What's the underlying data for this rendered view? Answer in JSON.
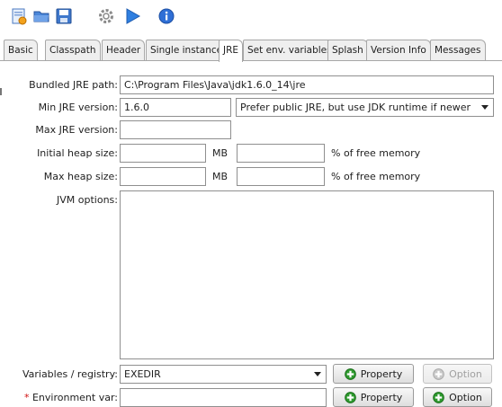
{
  "toolbar": {
    "icons": [
      "new-config-icon",
      "open-folder-icon",
      "save-icon",
      "gear-icon",
      "build-play-icon",
      "info-icon"
    ]
  },
  "tabs": [
    {
      "label": "Basic",
      "active": false
    },
    {
      "label": "Classpath",
      "active": false
    },
    {
      "label": "Header",
      "active": false
    },
    {
      "label": "Single instance",
      "active": false
    },
    {
      "label": "JRE",
      "active": true
    },
    {
      "label": "Set env. variables",
      "active": false
    },
    {
      "label": "Splash",
      "active": false
    },
    {
      "label": "Version Info",
      "active": false
    },
    {
      "label": "Messages",
      "active": false
    }
  ],
  "form": {
    "bundled_jre_label": "Bundled JRE path:",
    "bundled_jre_value": "C:\\Program Files\\Java\\jdk1.6.0_14\\jre",
    "min_jre_label": "Min JRE version:",
    "min_jre_value": "1.6.0",
    "jdk_preference": "Prefer public JRE, but use JDK runtime if newer",
    "max_jre_label": "Max JRE version:",
    "max_jre_value": "",
    "initial_heap_label": "Initial heap size:",
    "initial_heap_value": "",
    "initial_heap_percent_value": "",
    "max_heap_label": "Max heap size:",
    "max_heap_value": "",
    "max_heap_percent_value": "",
    "mb_unit": "MB",
    "percent_unit": "% of free memory",
    "jvm_options_label": "JVM options:",
    "jvm_options_value": "",
    "variables_label": "Variables / registry:",
    "variables_value": "EXEDIR",
    "env_var_required_mark": "*",
    "env_var_label": "Environment var:",
    "env_var_value": "",
    "property_label": "Property",
    "option_label": "Option"
  },
  "colors": {
    "accent_blue": "#2f6fd6",
    "plus_green": "#2e9a2e",
    "required_red": "#d01010"
  }
}
